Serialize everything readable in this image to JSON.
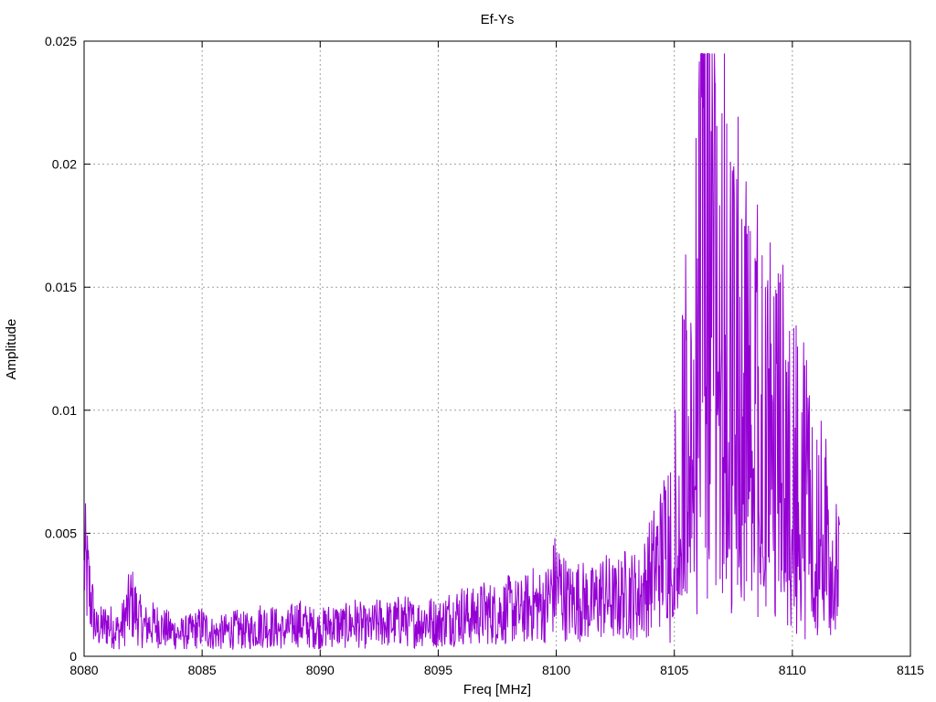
{
  "chart_data": {
    "type": "line",
    "title": "Ef-Ys",
    "xlabel": "Freq [MHz]",
    "ylabel": "Amplitude",
    "xlim": [
      8080,
      8115
    ],
    "ylim": [
      0,
      0.025
    ],
    "x_ticks": [
      "8080",
      "8085",
      "8090",
      "8095",
      "8100",
      "8105",
      "8110",
      "8115"
    ],
    "y_ticks": [
      "0",
      "0.005",
      "0.01",
      "0.015",
      "0.02",
      "0.025"
    ],
    "grid": true,
    "legend": "none",
    "series": [
      {
        "color": "#9400d3",
        "x": [
          8080.0,
          8080.5,
          8081.0,
          8081.5,
          8082.0,
          8082.5,
          8083.0,
          8083.5,
          8084.0,
          8084.5,
          8085.0,
          8085.5,
          8086.0,
          8086.5,
          8087.0,
          8087.5,
          8088.0,
          8088.5,
          8089.0,
          8089.5,
          8090.0,
          8090.5,
          8091.0,
          8091.5,
          8092.0,
          8092.5,
          8093.0,
          8093.5,
          8094.0,
          8094.5,
          8095.0,
          8095.5,
          8096.0,
          8096.5,
          8097.0,
          8097.5,
          8098.0,
          8098.5,
          8099.0,
          8099.5,
          8100.0,
          8100.5,
          8101.0,
          8101.5,
          8102.0,
          8102.5,
          8103.0,
          8103.5,
          8104.0,
          8104.5,
          8105.0,
          8105.5,
          8106.0,
          8106.2,
          8106.5,
          8107.0,
          8107.5,
          8108.0,
          8108.5,
          8109.0,
          8109.5,
          8110.0,
          8110.5,
          8111.0,
          8111.5,
          8112.0
        ],
        "y": [
          0.0039,
          0.0011,
          0.0013,
          0.001,
          0.0022,
          0.0012,
          0.0013,
          0.0011,
          0.0009,
          0.001,
          0.0012,
          0.0009,
          0.001,
          0.0011,
          0.001,
          0.0013,
          0.0012,
          0.001,
          0.0014,
          0.0012,
          0.0011,
          0.0013,
          0.0012,
          0.0014,
          0.0011,
          0.0014,
          0.0013,
          0.0015,
          0.0013,
          0.0015,
          0.0013,
          0.0016,
          0.0017,
          0.0016,
          0.0018,
          0.0017,
          0.0019,
          0.0018,
          0.0021,
          0.002,
          0.003,
          0.0022,
          0.0023,
          0.0021,
          0.0025,
          0.0022,
          0.0026,
          0.0024,
          0.0033,
          0.0042,
          0.0062,
          0.0095,
          0.014,
          0.0229,
          0.017,
          0.015,
          0.0135,
          0.012,
          0.011,
          0.0105,
          0.0095,
          0.0085,
          0.008,
          0.006,
          0.005,
          0.004
        ]
      }
    ]
  }
}
